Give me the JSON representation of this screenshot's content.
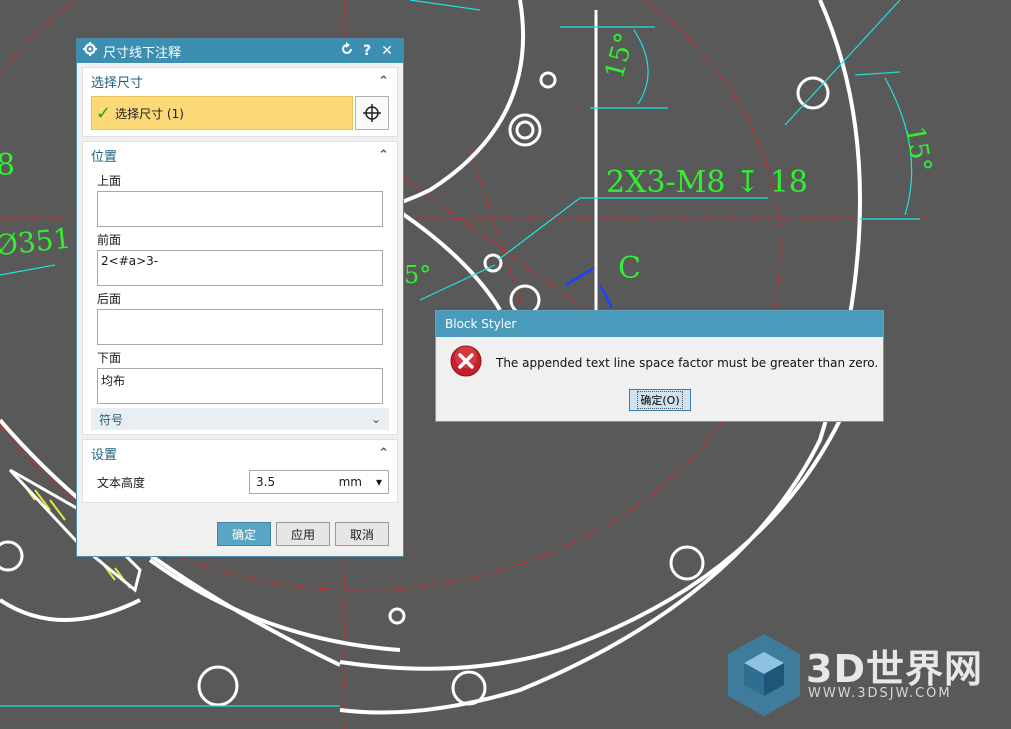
{
  "cad": {
    "annotation_thread": "2X3-M8",
    "annotation_depth_symbol": "↧",
    "annotation_depth": "18",
    "angle_label_1": "15°",
    "angle_label_2": "15°",
    "angle_label_3": "5°",
    "letter_c": "C",
    "left_text_1": "8",
    "left_text_2": "Ø351"
  },
  "dialog": {
    "title": "尺寸线下注释",
    "reset_icon": "reset-icon",
    "help_label": "?",
    "close_label": "✕",
    "select_group": {
      "title": "选择尺寸",
      "selected_text": "选择尺寸 (1)",
      "check_icon": "check-icon",
      "pick_icon": "crosshair-icon"
    },
    "position_group": {
      "title": "位置",
      "above_label": "上面",
      "above_value": "",
      "before_label": "前面",
      "before_value": "2<#a>3-",
      "after_label": "后面",
      "after_value": "",
      "below_label": "下面",
      "below_value": "均布",
      "symbol_label": "符号"
    },
    "settings_group": {
      "title": "设置",
      "text_height_label": "文本高度",
      "text_height_value": "3.5",
      "text_height_unit": "mm"
    },
    "ok_label": "确定",
    "apply_label": "应用",
    "cancel_label": "取消"
  },
  "message_box": {
    "title": "Block Styler",
    "icon": "error-icon",
    "text": "The appended text line space factor must be greater than zero.",
    "ok_label": "确定(O)"
  },
  "watermark": {
    "brand": "3D世界网",
    "url": "WWW.3DSJW.COM"
  },
  "colors": {
    "background": "#595959",
    "cad_lines": "#ffffff",
    "center_lines": "#e02020",
    "dimension_lines": "#20e0e0",
    "annotation_text": "#33ee33",
    "dialog_title": "#3c8fb0",
    "selected_fill": "#fcd977"
  }
}
